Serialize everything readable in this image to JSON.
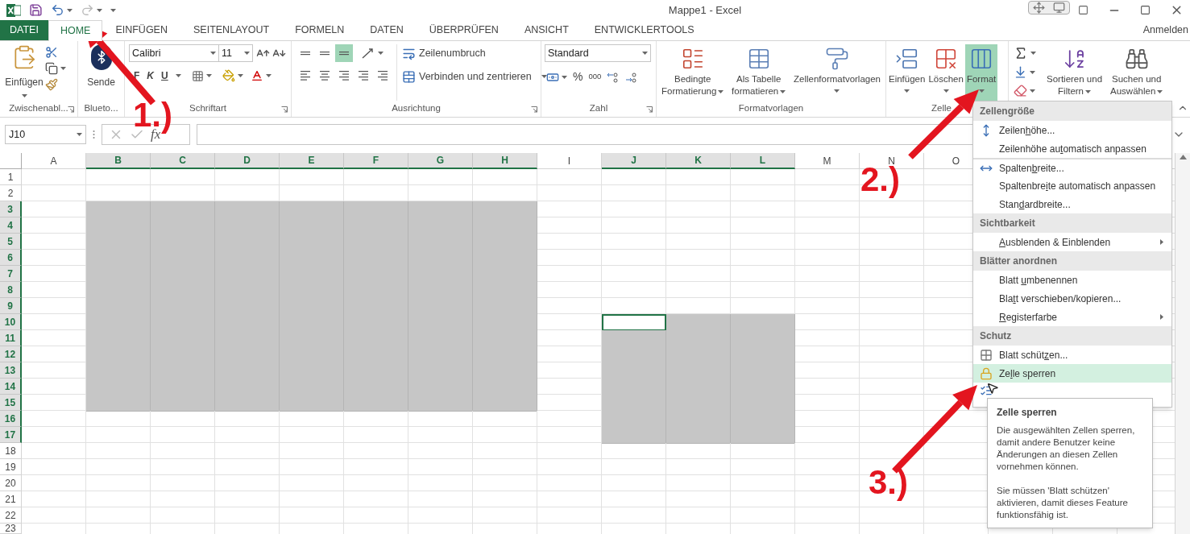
{
  "window": {
    "title": "Mappe1 - Excel"
  },
  "tabs": [
    {
      "label": "DATEI",
      "kind": "file",
      "selected": false
    },
    {
      "label": "HOME",
      "kind": "tab",
      "selected": true
    },
    {
      "label": "EINFÜGEN",
      "kind": "tab",
      "selected": false
    },
    {
      "label": "SEITENLAYOUT",
      "kind": "tab",
      "selected": false
    },
    {
      "label": "FORMELN",
      "kind": "tab",
      "selected": false
    },
    {
      "label": "DATEN",
      "kind": "tab",
      "selected": false
    },
    {
      "label": "ÜBERPRÜFEN",
      "kind": "tab",
      "selected": false
    },
    {
      "label": "ANSICHT",
      "kind": "tab",
      "selected": false
    },
    {
      "label": "ENTWICKLERTOOLS",
      "kind": "tab",
      "selected": false
    }
  ],
  "account": "Anmelden",
  "ribbon": {
    "clipboard": {
      "label": "Zwischenabl...",
      "paste": "Einfügen"
    },
    "bluetooth": {
      "label": "Blueto...",
      "send": "Sende"
    },
    "font": {
      "label": "Schriftart",
      "font_name": "Calibri",
      "font_size": "11",
      "bold": "F",
      "italic": "K",
      "underline": "U"
    },
    "alignment": {
      "label": "Ausrichtung",
      "middle_selected": true,
      "wrap": "Zeilenumbruch",
      "merge": "Verbinden und zentrieren"
    },
    "number": {
      "label": "Zahl",
      "format": "Standard",
      "percent": "%",
      "thousands": "000"
    },
    "styles": {
      "label": "Formatvorlagen",
      "buttons": [
        {
          "lines": [
            "Bedingte",
            "Formatierung"
          ]
        },
        {
          "lines": [
            "Als Tabelle",
            "formatieren"
          ]
        },
        {
          "lines": [
            "Zellenformatvorlagen"
          ]
        }
      ]
    },
    "cells": {
      "label": "Zelle",
      "buttons": [
        {
          "label": "Einfügen",
          "selected": false
        },
        {
          "label": "Löschen",
          "selected": false
        },
        {
          "label": "Format",
          "selected": true
        }
      ]
    },
    "editing": {
      "buttons": [
        {
          "lines": [
            "Sortieren und",
            "Filtern"
          ]
        },
        {
          "lines": [
            "Suchen und",
            "Auswählen"
          ]
        }
      ]
    }
  },
  "formula_bar": {
    "name_box": "J10",
    "fx": "fx"
  },
  "grid": {
    "columns": [
      {
        "label": "A",
        "selected": false
      },
      {
        "label": "B",
        "selected": true
      },
      {
        "label": "C",
        "selected": true
      },
      {
        "label": "D",
        "selected": true
      },
      {
        "label": "E",
        "selected": true
      },
      {
        "label": "F",
        "selected": true
      },
      {
        "label": "G",
        "selected": true
      },
      {
        "label": "H",
        "selected": true
      },
      {
        "label": "I",
        "selected": false
      },
      {
        "label": "J",
        "selected": true
      },
      {
        "label": "K",
        "selected": true
      },
      {
        "label": "L",
        "selected": true
      },
      {
        "label": "M",
        "selected": false
      },
      {
        "label": "N",
        "selected": false
      },
      {
        "label": "O",
        "selected": false
      }
    ],
    "rows": [
      {
        "label": "1",
        "selected": false,
        "shaded": [
          false,
          false,
          false,
          false,
          false,
          false,
          false,
          false,
          false,
          false,
          false,
          false,
          false,
          false,
          false
        ],
        "active": [
          false,
          false,
          false,
          false,
          false,
          false,
          false,
          false,
          false,
          false,
          false,
          false,
          false,
          false,
          false
        ]
      },
      {
        "label": "2",
        "selected": false,
        "shaded": [
          false,
          false,
          false,
          false,
          false,
          false,
          false,
          false,
          false,
          false,
          false,
          false,
          false,
          false,
          false
        ],
        "active": [
          false,
          false,
          false,
          false,
          false,
          false,
          false,
          false,
          false,
          false,
          false,
          false,
          false,
          false,
          false
        ]
      },
      {
        "label": "3",
        "selected": true,
        "shaded": [
          false,
          true,
          true,
          true,
          true,
          true,
          true,
          true,
          false,
          false,
          false,
          false,
          false,
          false,
          false
        ],
        "active": [
          false,
          false,
          false,
          false,
          false,
          false,
          false,
          false,
          false,
          false,
          false,
          false,
          false,
          false,
          false
        ]
      },
      {
        "label": "4",
        "selected": true,
        "shaded": [
          false,
          true,
          true,
          true,
          true,
          true,
          true,
          true,
          false,
          false,
          false,
          false,
          false,
          false,
          false
        ],
        "active": [
          false,
          false,
          false,
          false,
          false,
          false,
          false,
          false,
          false,
          false,
          false,
          false,
          false,
          false,
          false
        ]
      },
      {
        "label": "5",
        "selected": true,
        "shaded": [
          false,
          true,
          true,
          true,
          true,
          true,
          true,
          true,
          false,
          false,
          false,
          false,
          false,
          false,
          false
        ],
        "active": [
          false,
          false,
          false,
          false,
          false,
          false,
          false,
          false,
          false,
          false,
          false,
          false,
          false,
          false,
          false
        ]
      },
      {
        "label": "6",
        "selected": true,
        "shaded": [
          false,
          true,
          true,
          true,
          true,
          true,
          true,
          true,
          false,
          false,
          false,
          false,
          false,
          false,
          false
        ],
        "active": [
          false,
          false,
          false,
          false,
          false,
          false,
          false,
          false,
          false,
          false,
          false,
          false,
          false,
          false,
          false
        ]
      },
      {
        "label": "7",
        "selected": true,
        "shaded": [
          false,
          true,
          true,
          true,
          true,
          true,
          true,
          true,
          false,
          false,
          false,
          false,
          false,
          false,
          false
        ],
        "active": [
          false,
          false,
          false,
          false,
          false,
          false,
          false,
          false,
          false,
          false,
          false,
          false,
          false,
          false,
          false
        ]
      },
      {
        "label": "8",
        "selected": true,
        "shaded": [
          false,
          true,
          true,
          true,
          true,
          true,
          true,
          true,
          false,
          false,
          false,
          false,
          false,
          false,
          false
        ],
        "active": [
          false,
          false,
          false,
          false,
          false,
          false,
          false,
          false,
          false,
          false,
          false,
          false,
          false,
          false,
          false
        ]
      },
      {
        "label": "9",
        "selected": true,
        "shaded": [
          false,
          true,
          true,
          true,
          true,
          true,
          true,
          true,
          false,
          false,
          false,
          false,
          false,
          false,
          false
        ],
        "active": [
          false,
          false,
          false,
          false,
          false,
          false,
          false,
          false,
          false,
          false,
          false,
          false,
          false,
          false,
          false
        ]
      },
      {
        "label": "10",
        "selected": true,
        "shaded": [
          false,
          true,
          true,
          true,
          true,
          true,
          true,
          true,
          false,
          false,
          true,
          true,
          false,
          false,
          false
        ],
        "active": [
          false,
          false,
          false,
          false,
          false,
          false,
          false,
          false,
          false,
          true,
          false,
          false,
          false,
          false,
          false
        ]
      },
      {
        "label": "11",
        "selected": true,
        "shaded": [
          false,
          true,
          true,
          true,
          true,
          true,
          true,
          true,
          false,
          true,
          true,
          true,
          false,
          false,
          false
        ],
        "active": [
          false,
          false,
          false,
          false,
          false,
          false,
          false,
          false,
          false,
          false,
          false,
          false,
          false,
          false,
          false
        ]
      },
      {
        "label": "12",
        "selected": true,
        "shaded": [
          false,
          true,
          true,
          true,
          true,
          true,
          true,
          true,
          false,
          true,
          true,
          true,
          false,
          false,
          false
        ],
        "active": [
          false,
          false,
          false,
          false,
          false,
          false,
          false,
          false,
          false,
          false,
          false,
          false,
          false,
          false,
          false
        ]
      },
      {
        "label": "13",
        "selected": true,
        "shaded": [
          false,
          true,
          true,
          true,
          true,
          true,
          true,
          true,
          false,
          true,
          true,
          true,
          false,
          false,
          false
        ],
        "active": [
          false,
          false,
          false,
          false,
          false,
          false,
          false,
          false,
          false,
          false,
          false,
          false,
          false,
          false,
          false
        ]
      },
      {
        "label": "14",
        "selected": true,
        "shaded": [
          false,
          true,
          true,
          true,
          true,
          true,
          true,
          true,
          false,
          true,
          true,
          true,
          false,
          false,
          false
        ],
        "active": [
          false,
          false,
          false,
          false,
          false,
          false,
          false,
          false,
          false,
          false,
          false,
          false,
          false,
          false,
          false
        ]
      },
      {
        "label": "15",
        "selected": true,
        "shaded": [
          false,
          true,
          true,
          true,
          true,
          true,
          true,
          true,
          false,
          true,
          true,
          true,
          false,
          false,
          false
        ],
        "active": [
          false,
          false,
          false,
          false,
          false,
          false,
          false,
          false,
          false,
          false,
          false,
          false,
          false,
          false,
          false
        ]
      },
      {
        "label": "16",
        "selected": true,
        "shaded": [
          false,
          false,
          false,
          false,
          false,
          false,
          false,
          false,
          false,
          true,
          true,
          true,
          false,
          false,
          false
        ],
        "active": [
          false,
          false,
          false,
          false,
          false,
          false,
          false,
          false,
          false,
          false,
          false,
          false,
          false,
          false,
          false
        ]
      },
      {
        "label": "17",
        "selected": true,
        "shaded": [
          false,
          false,
          false,
          false,
          false,
          false,
          false,
          false,
          false,
          true,
          true,
          true,
          false,
          false,
          false
        ],
        "active": [
          false,
          false,
          false,
          false,
          false,
          false,
          false,
          false,
          false,
          false,
          false,
          false,
          false,
          false,
          false
        ]
      },
      {
        "label": "18",
        "selected": false,
        "shaded": [
          false,
          false,
          false,
          false,
          false,
          false,
          false,
          false,
          false,
          false,
          false,
          false,
          false,
          false,
          false
        ],
        "active": [
          false,
          false,
          false,
          false,
          false,
          false,
          false,
          false,
          false,
          false,
          false,
          false,
          false,
          false,
          false
        ]
      },
      {
        "label": "19",
        "selected": false,
        "shaded": [
          false,
          false,
          false,
          false,
          false,
          false,
          false,
          false,
          false,
          false,
          false,
          false,
          false,
          false,
          false
        ],
        "active": [
          false,
          false,
          false,
          false,
          false,
          false,
          false,
          false,
          false,
          false,
          false,
          false,
          false,
          false,
          false
        ]
      },
      {
        "label": "20",
        "selected": false,
        "shaded": [
          false,
          false,
          false,
          false,
          false,
          false,
          false,
          false,
          false,
          false,
          false,
          false,
          false,
          false,
          false
        ],
        "active": [
          false,
          false,
          false,
          false,
          false,
          false,
          false,
          false,
          false,
          false,
          false,
          false,
          false,
          false,
          false
        ]
      },
      {
        "label": "21",
        "selected": false,
        "shaded": [
          false,
          false,
          false,
          false,
          false,
          false,
          false,
          false,
          false,
          false,
          false,
          false,
          false,
          false,
          false
        ],
        "active": [
          false,
          false,
          false,
          false,
          false,
          false,
          false,
          false,
          false,
          false,
          false,
          false,
          false,
          false,
          false
        ]
      },
      {
        "label": "22",
        "selected": false,
        "shaded": [
          false,
          false,
          false,
          false,
          false,
          false,
          false,
          false,
          false,
          false,
          false,
          false,
          false,
          false,
          false
        ],
        "active": [
          false,
          false,
          false,
          false,
          false,
          false,
          false,
          false,
          false,
          false,
          false,
          false,
          false,
          false,
          false
        ]
      },
      {
        "label": "23",
        "selected": false,
        "shaded": [
          false,
          false,
          false,
          false,
          false,
          false,
          false,
          false,
          false,
          false,
          false,
          false,
          false,
          false,
          false
        ],
        "active": [
          false,
          false,
          false,
          false,
          false,
          false,
          false,
          false,
          false,
          false,
          false,
          false,
          false,
          false,
          false
        ]
      }
    ]
  },
  "format_menu": {
    "sections": [
      {
        "header": "Zellengröße",
        "items": [
          {
            "label": {
              "before": "Zeilen",
              "key": "h",
              "after": "öhe..."
            },
            "separator_above": false,
            "submenu": false,
            "selected": false
          },
          {
            "label": {
              "before": "Zeilenhöhe au",
              "key": "t",
              "after": "omatisch anpassen"
            },
            "separator_above": false,
            "submenu": false,
            "selected": false
          },
          {
            "label": {
              "before": "Spalten",
              "key": "b",
              "after": "reite..."
            },
            "separator_above": true,
            "submenu": false,
            "selected": false
          },
          {
            "label": {
              "before": "Spaltenbre",
              "key": "i",
              "after": "te automatisch anpassen"
            },
            "separator_above": false,
            "submenu": false,
            "selected": false
          },
          {
            "label": {
              "before": "Stan",
              "key": "d",
              "after": "ardbreite..."
            },
            "separator_above": false,
            "submenu": false,
            "selected": false
          }
        ]
      },
      {
        "header": "Sichtbarkeit",
        "items": [
          {
            "label": {
              "key": "A",
              "after": "usblenden & Einblenden"
            },
            "separator_above": false,
            "submenu": true,
            "selected": false
          }
        ]
      },
      {
        "header": "Blätter anordnen",
        "items": [
          {
            "label": {
              "before": "Blatt ",
              "key": "u",
              "after": "mbenennen"
            },
            "separator_above": false,
            "submenu": false,
            "selected": false
          },
          {
            "label": {
              "before": "Bla",
              "key": "t",
              "after": "t verschieben/kopieren..."
            },
            "separator_above": false,
            "submenu": false,
            "selected": false
          },
          {
            "label": {
              "key": "R",
              "after": "egisterfarbe"
            },
            "separator_above": false,
            "submenu": true,
            "selected": false
          }
        ]
      },
      {
        "header": "Schutz",
        "items": [
          {
            "label": {
              "before": "Blatt schüt",
              "key": "z",
              "after": "en..."
            },
            "separator_above": false,
            "submenu": false,
            "selected": false
          },
          {
            "label": {
              "before": "Ze",
              "key": "l",
              "after": "le sperren"
            },
            "separator_above": false,
            "submenu": false,
            "selected": true
          }
        ]
      }
    ]
  },
  "tooltip": {
    "title": "Zelle sperren",
    "paragraphs": [
      "Die ausgewählten Zellen sperren, damit andere Benutzer keine Änderungen an diesen Zellen vornehmen können.",
      "Sie müssen 'Blatt schützen' aktivieren, damit dieses Feature funktionsfähig ist."
    ]
  },
  "annotations": [
    {
      "label": "1.)"
    },
    {
      "label": "2.)"
    },
    {
      "label": "3.)"
    }
  ]
}
